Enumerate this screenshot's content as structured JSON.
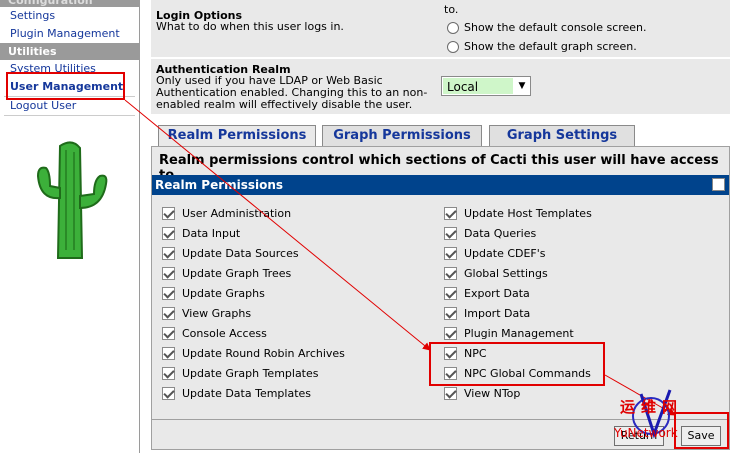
{
  "sidebar": {
    "section_top": "Configuration",
    "links_top": [
      "Settings",
      "Plugin Management"
    ],
    "section_utilities": "Utilities",
    "links_utilities": [
      "System Utilities",
      "User Management",
      "Logout User"
    ]
  },
  "login_options": {
    "title": "Login Options",
    "desc": "What to do when this user logs in.",
    "top_fragment": "to.",
    "radios": [
      "Show the default console screen.",
      "Show the default graph screen."
    ]
  },
  "auth_realm": {
    "title": "Authentication Realm",
    "desc_lines": [
      "Only used if you have LDAP or Web Basic",
      "Authentication enabled. Changing this to an non-",
      "enabled realm will effectively disable the user."
    ],
    "selected": "Local"
  },
  "tabs": [
    "Realm Permissions",
    "Graph Permissions",
    "Graph Settings"
  ],
  "realm": {
    "description": "Realm permissions control which sections of Cacti this user will have access to.",
    "header": "Realm Permissions",
    "left": [
      "User Administration",
      "Data Input",
      "Update Data Sources",
      "Update Graph Trees",
      "Update Graphs",
      "View Graphs",
      "Console Access",
      "Update Round Robin Archives",
      "Update Graph Templates",
      "Update Data Templates"
    ],
    "right": [
      "Update Host Templates",
      "Data Queries",
      "Update CDEF's",
      "Global Settings",
      "Export Data",
      "Import Data",
      "Plugin Management",
      "NPC",
      "NPC Global Commands",
      "View NTop"
    ]
  },
  "buttons": {
    "return": "Return",
    "save": "Save"
  },
  "watermark": {
    "cn": "运维网",
    "en": "YuNetwork"
  },
  "colors": {
    "header_bar": "#00438c",
    "tab_text": "#15379b",
    "annotation": "#e10000"
  }
}
